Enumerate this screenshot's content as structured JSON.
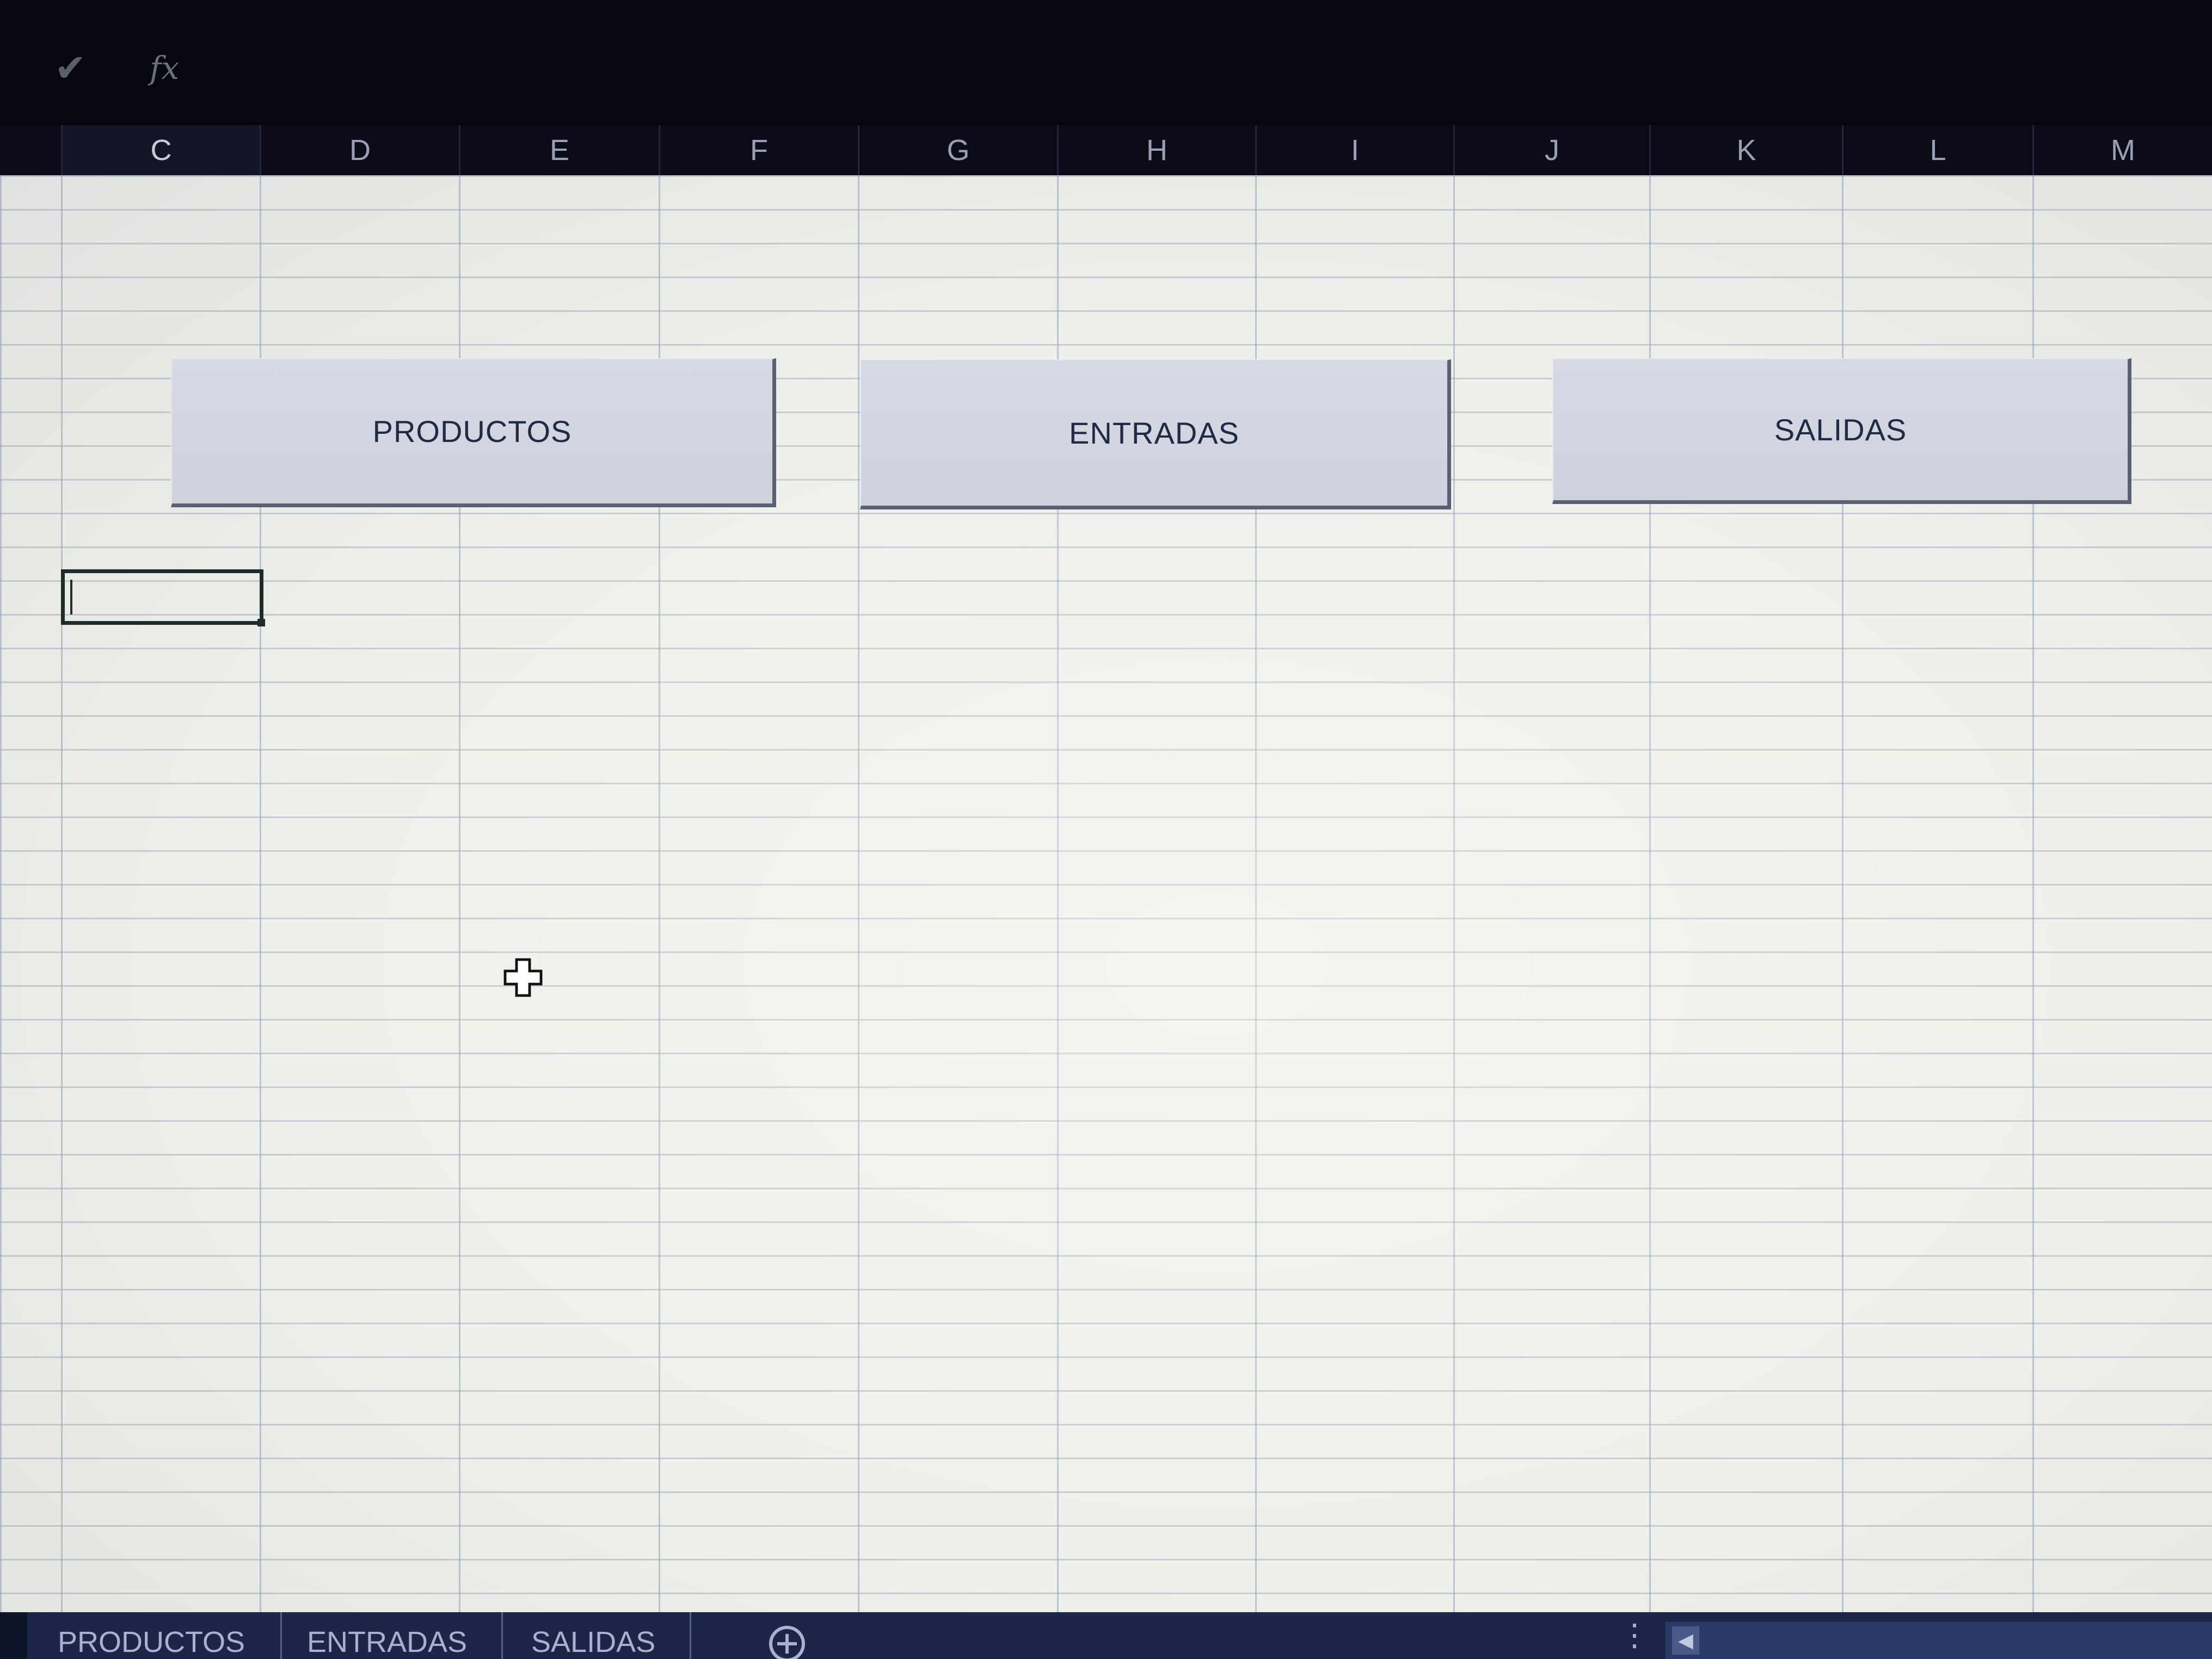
{
  "formula_bar": {
    "enter_icon": "checkmark-icon",
    "function_icon": "fx-icon",
    "function_label": "fx"
  },
  "columns": [
    "C",
    "D",
    "E",
    "F",
    "G",
    "H",
    "I",
    "J",
    "K",
    "L",
    "M"
  ],
  "buttons": {
    "productos": "PRODUCTOS",
    "entradas": "ENTRADAS",
    "salidas": "SALIDAS"
  },
  "sheet_tabs": [
    "PRODUCTOS",
    "ENTRADAS",
    "SALIDAS"
  ],
  "colors": {
    "formula_bar_bg": "#07070f",
    "header_bg": "#0b0c18",
    "grid_bg": "#eef0ea",
    "button_bg": "#d6d9e3",
    "button_text": "#1f2a44",
    "tab_bar_bg": "#1c2748"
  },
  "icons": {
    "cursor": "cell-select-cross-icon",
    "add_sheet": "plus-circle-icon",
    "tab_menu": "vertical-dots-icon",
    "scroll_left": "scroll-left-arrow-icon"
  }
}
